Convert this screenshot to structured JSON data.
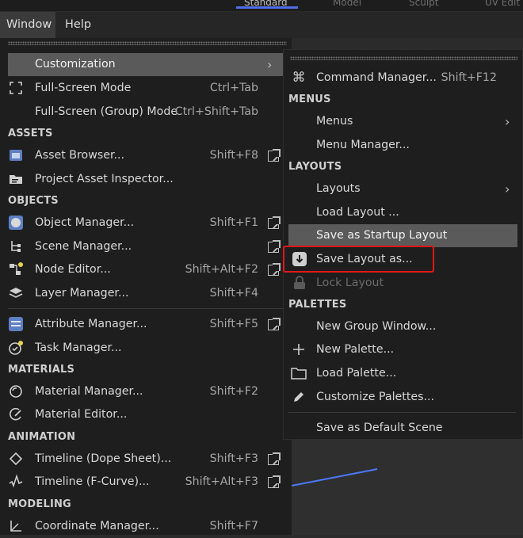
{
  "top_tabs": [
    "Standard",
    "Model",
    "Sculpt",
    "UV Edit"
  ],
  "menubar": {
    "window": "Window",
    "help": "Help"
  },
  "left_menu": {
    "items": [
      {
        "label": "Customization"
      },
      {
        "label": "Full-Screen Mode",
        "shortcut": "Ctrl+Tab"
      },
      {
        "label": "Full-Screen (Group) Mode",
        "shortcut": "Ctrl+Shift+Tab"
      },
      {
        "label": "Asset Browser...",
        "shortcut": "Shift+F8"
      },
      {
        "label": "Project Asset Inspector..."
      },
      {
        "label": "Object Manager...",
        "shortcut": "Shift+F1"
      },
      {
        "label": "Scene Manager..."
      },
      {
        "label": "Node Editor...",
        "shortcut": "Shift+Alt+F2"
      },
      {
        "label": "Layer Manager...",
        "shortcut": "Shift+F4"
      },
      {
        "label": "Attribute Manager...",
        "shortcut": "Shift+F5"
      },
      {
        "label": "Task Manager..."
      },
      {
        "label": "Material Manager...",
        "shortcut": "Shift+F2"
      },
      {
        "label": "Material Editor..."
      },
      {
        "label": "Timeline (Dope Sheet)...",
        "shortcut": "Shift+F3"
      },
      {
        "label": "Timeline (F-Curve)...",
        "shortcut": "Shift+Alt+F3"
      },
      {
        "label": "Coordinate Manager...",
        "shortcut": "Shift+F7"
      }
    ],
    "headers": {
      "assets": "ASSETS",
      "objects": "OBJECTS",
      "materials": "MATERIALS",
      "animation": "ANIMATION",
      "modeling": "MODELING"
    }
  },
  "right_menu": {
    "items": [
      {
        "label": "Command Manager...",
        "shortcut": "Shift+F12"
      },
      {
        "label": "Menus"
      },
      {
        "label": "Menu Manager..."
      },
      {
        "label": "Layouts"
      },
      {
        "label": "Load Layout ..."
      },
      {
        "label": "Save as Startup Layout"
      },
      {
        "label": "Save Layout as..."
      },
      {
        "label": "Lock Layout"
      },
      {
        "label": "New Group Window..."
      },
      {
        "label": "New Palette..."
      },
      {
        "label": "Load Palette..."
      },
      {
        "label": "Customize Palettes..."
      },
      {
        "label": "Save as Default Scene"
      }
    ],
    "headers": {
      "menus": "MENUS",
      "layouts": "LAYOUTS",
      "palettes": "PALETTES"
    }
  },
  "colors": {
    "highlight": "#5a5a5a",
    "annotation": "#e01818",
    "tab_accent": "#4f6ee8",
    "menu_bg": "#1e1e1e"
  },
  "icons": [
    "fullscreen-icon",
    "asset-browser-icon",
    "project-asset-icon",
    "object-manager-icon",
    "scene-manager-icon",
    "node-editor-icon",
    "layer-icon",
    "attribute-manager-icon",
    "task-manager-icon",
    "material-manager-icon",
    "material-editor-icon",
    "dope-sheet-icon",
    "fcurve-icon",
    "coordinate-icon",
    "command-icon",
    "save-layout-icon",
    "lock-icon",
    "plus-icon",
    "folder-icon",
    "pencil-icon",
    "chevron-right-icon",
    "external-window-icon"
  ]
}
